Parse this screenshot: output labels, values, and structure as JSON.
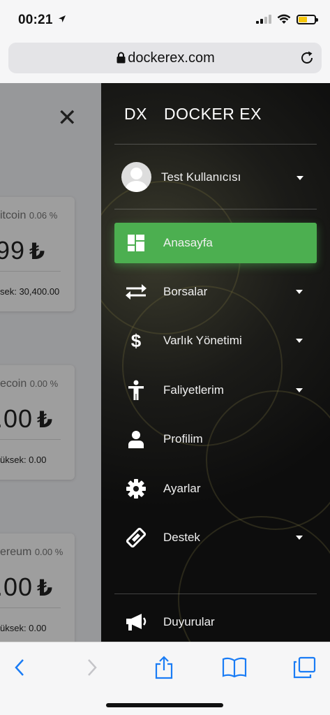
{
  "status": {
    "time": "00:21"
  },
  "browser": {
    "url": "dockerex.com"
  },
  "page": {
    "coins": [
      {
        "name": "itcoin",
        "change": "0.06 %",
        "price": "99",
        "currency": "₺",
        "high": "sek: 30,400.00"
      },
      {
        "name": "ecoin",
        "change": "0.00 %",
        "price": ".00",
        "currency": "₺",
        "high": "üksek: 0.00"
      },
      {
        "name": "ereum",
        "change": "0.00 %",
        "price": ".00",
        "currency": "₺",
        "high": "üksek: 0.00"
      }
    ]
  },
  "drawer": {
    "logo": "DX",
    "brand": "DOCKER EX",
    "user": "Test Kullanıcısı",
    "items": [
      {
        "label": "Anasayfa",
        "icon": "dashboard-icon",
        "active": true,
        "has_caret": false
      },
      {
        "label": "Borsalar",
        "icon": "swap-arrows-icon",
        "active": false,
        "has_caret": true
      },
      {
        "label": "Varlık Yönetimi",
        "icon": "dollar-icon",
        "active": false,
        "has_caret": true
      },
      {
        "label": "Faliyetlerim",
        "icon": "accessibility-person-icon",
        "active": false,
        "has_caret": true
      },
      {
        "label": "Profilim",
        "icon": "user-icon",
        "active": false,
        "has_caret": false
      },
      {
        "label": "Ayarlar",
        "icon": "gear-icon",
        "active": false,
        "has_caret": false
      },
      {
        "label": "Destek",
        "icon": "ticket-icon",
        "active": false,
        "has_caret": true
      },
      {
        "label": "Duyurular",
        "icon": "megaphone-icon",
        "active": false,
        "has_caret": false
      }
    ]
  },
  "colors": {
    "active": "#4caf50",
    "ios_blue": "#1a7cf5"
  }
}
